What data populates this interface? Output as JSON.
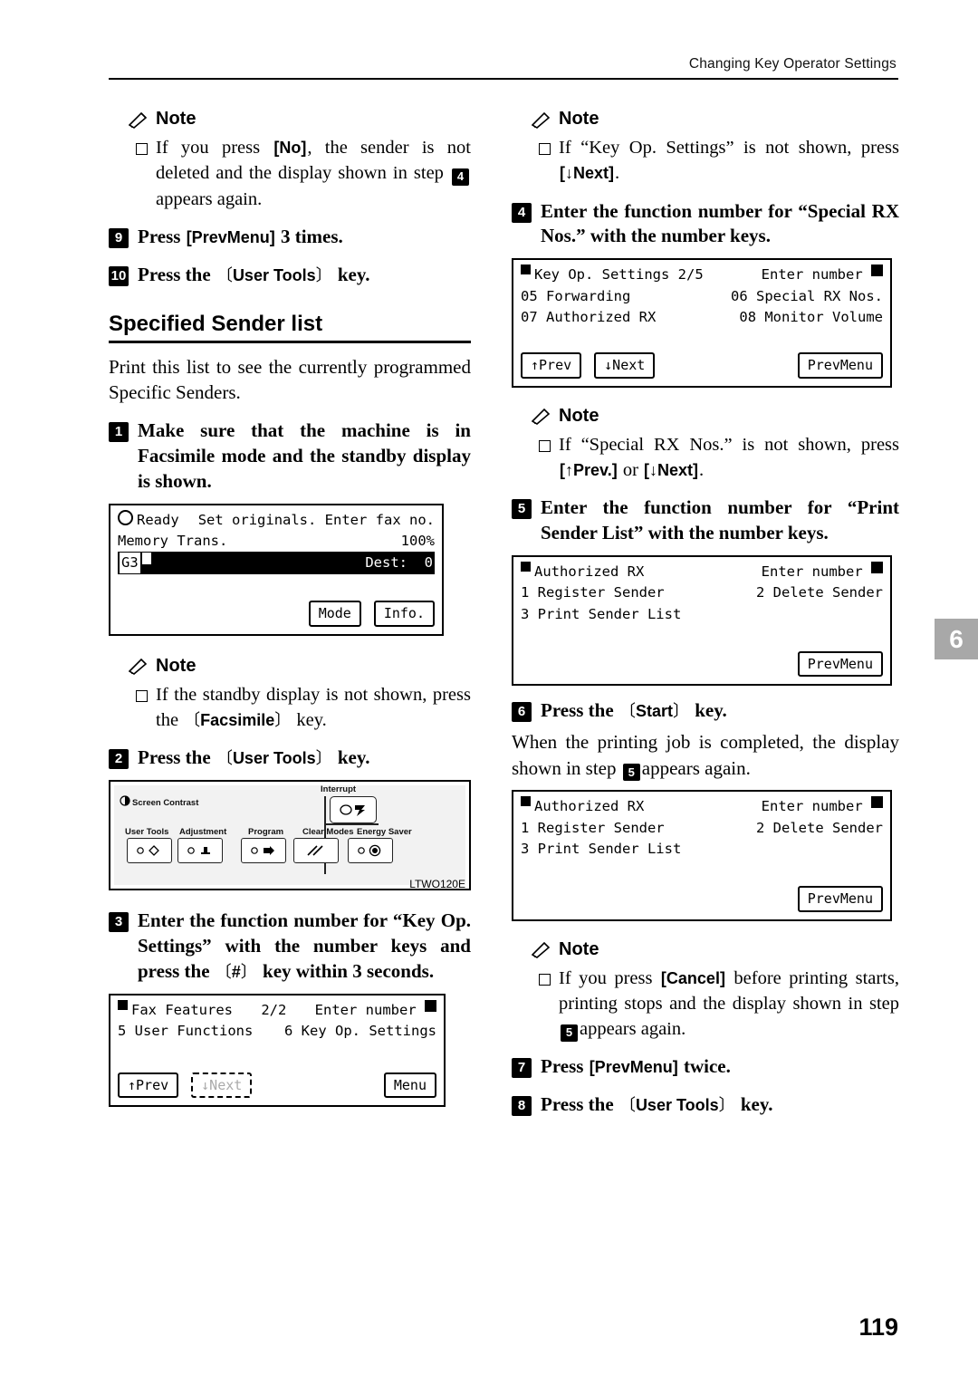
{
  "header": {
    "running_head": "Changing Key Operator Settings"
  },
  "chapter_tab": "6",
  "folio": "119",
  "left": {
    "note1": {
      "label": "Note",
      "items": [
        {
          "pre": "If you press ",
          "key": "[No]",
          "mid": ", the sender is not deleted and the display shown in step ",
          "num": "4",
          "post": "appears again."
        }
      ]
    },
    "step9": {
      "num": "9",
      "text_pre": "Press ",
      "key": "[PrevMenu]",
      "text_post": " 3 times."
    },
    "step10": {
      "num": "10",
      "text_pre": "Press the ",
      "key": "User Tools",
      "text_post": " key."
    },
    "section_title": "Specified Sender list",
    "intro": "Print this list to see the currently programmed Specific Senders.",
    "step1": {
      "num": "1",
      "text": "Make sure that the machine is in Facsimile mode and the standby display is shown."
    },
    "lcd_standby": {
      "row1_left": "Ready",
      "row1_right": "Set originals. Enter fax no.",
      "row2_left": "Memory Trans.",
      "row2_right": "100%",
      "row3_left": "",
      "row3_right": "Dest:  0",
      "buttons": [
        "Mode",
        "Info."
      ]
    },
    "note2": {
      "label": "Note",
      "items": [
        {
          "pre": "If the standby display is not shown, press the ",
          "key": "Facsimile",
          "post": " key."
        }
      ]
    },
    "step2": {
      "num": "2",
      "text_pre": "Press the ",
      "key": "User Tools",
      "text_post": " key."
    },
    "panel": {
      "caption": "LTWO120E",
      "screen_contrast": "Screen Contrast",
      "interrupt": "Interrupt",
      "keys": [
        "User Tools",
        "Adjustment",
        "Program",
        "Clear Modes",
        "Energy Saver"
      ]
    },
    "step3": {
      "num": "3",
      "text_pre": "Enter the function number for “Key Op. Settings” with the number keys and press the ",
      "key": "#",
      "text_post": " key within 3 seconds."
    },
    "lcd_fax_features": {
      "title": "Fax Features",
      "page": "2/2",
      "prompt": "Enter number",
      "item1": "5 User Functions",
      "item2": "6 Key Op. Settings",
      "buttons": [
        "↑Prev",
        "↓Next",
        "Menu"
      ]
    }
  },
  "right": {
    "note1": {
      "label": "Note",
      "items": [
        {
          "pre": "If “Key Op. Settings” is not shown, press ",
          "key": "[↓Next]",
          "post": "."
        }
      ]
    },
    "step4": {
      "num": "4",
      "text": "Enter the function number for “Special RX Nos.” with the number keys."
    },
    "lcd_keyop": {
      "title": "Key Op. Settings",
      "page": "2/5",
      "prompt": "Enter number",
      "item1": "05 Forwarding",
      "item2": "06 Special RX Nos.",
      "item3": "07 Authorized RX",
      "item4": "08 Monitor Volume",
      "buttons": [
        "↑Prev",
        "↓Next",
        "PrevMenu"
      ]
    },
    "note2": {
      "label": "Note",
      "items": [
        {
          "pre": "If “Special RX Nos.” is not shown, press ",
          "key": "[↑Prev.]",
          "mid": " or ",
          "key2": "[↓Next]",
          "post": "."
        }
      ]
    },
    "step5": {
      "num": "5",
      "text": "Enter the function number for “Print Sender List” with the number keys."
    },
    "lcd_auth1": {
      "title": "Authorized RX",
      "prompt": "Enter number",
      "item1": "1 Register Sender",
      "item2": "2 Delete Sender",
      "item3": "3 Print Sender List",
      "button": "PrevMenu"
    },
    "step6": {
      "num": "6",
      "text_pre": "Press the ",
      "key": "Start",
      "text_post": " key."
    },
    "step6_body": {
      "pre": "When the printing job is completed, the display shown in step ",
      "num": "5",
      "post": "appears again."
    },
    "lcd_auth2": {
      "title": "Authorized RX",
      "prompt": "Enter number",
      "item1": "1 Register Sender",
      "item2": "2 Delete Sender",
      "item3": "3 Print Sender List",
      "button": "PrevMenu"
    },
    "note3": {
      "label": "Note",
      "items": [
        {
          "pre": "If you press ",
          "key": "[Cancel]",
          "mid": " before printing starts, printing stops and the display shown in step ",
          "num": "5",
          "post": "appears again."
        }
      ]
    },
    "step7": {
      "num": "7",
      "text_pre": "Press ",
      "key": "[PrevMenu]",
      "text_post": " twice."
    },
    "step8": {
      "num": "8",
      "text_pre": "Press the ",
      "key": "User Tools",
      "text_post": " key."
    }
  }
}
